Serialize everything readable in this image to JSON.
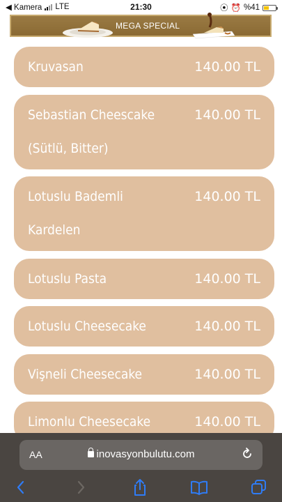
{
  "status_bar": {
    "back_label": "◀ Kamera",
    "network": "LTE",
    "time": "21:30",
    "battery": "%41",
    "battery_level": 0.41
  },
  "banner": {
    "title": "MEGA SPECIAL"
  },
  "menu": {
    "items": [
      {
        "name_lines": [
          "Kruvasan"
        ],
        "price": "140.00 TL"
      },
      {
        "name_lines": [
          "Sebastian Cheescake",
          "(Sütlü, Bitter)"
        ],
        "price": "140.00 TL"
      },
      {
        "name_lines": [
          "Lotuslu Bademli",
          "Kardelen"
        ],
        "price": "140.00 TL"
      },
      {
        "name_lines": [
          "Lotuslu Pasta"
        ],
        "price": "140.00 TL"
      },
      {
        "name_lines": [
          "Lotuslu Cheesecake"
        ],
        "price": "140.00 TL"
      },
      {
        "name_lines": [
          "Vişneli Cheesecake"
        ],
        "price": "140.00 TL"
      },
      {
        "name_lines": [
          "Limonlu Cheesecake"
        ],
        "price": "140.00 TL"
      }
    ]
  },
  "browser": {
    "aa_label": "AA",
    "url": "inovasyonbulutu.com"
  },
  "colors": {
    "card": "#e0bf9f",
    "banner": "#8a6a34",
    "browser_bg": "#4a4541",
    "accent": "#2f7cf6"
  }
}
